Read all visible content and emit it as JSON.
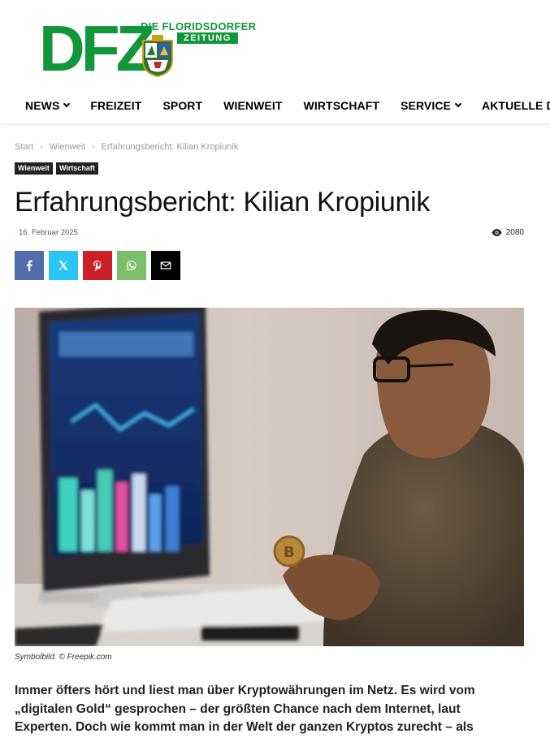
{
  "logo": {
    "main": "DFZ",
    "line1": "DIE FLORIDSDORFER",
    "line2": "ZEITUNG",
    "crest_icon": "coat-of-arms-icon"
  },
  "nav": {
    "items": [
      {
        "label": "NEWS",
        "dropdown": true
      },
      {
        "label": "FREIZEIT",
        "dropdown": false
      },
      {
        "label": "SPORT",
        "dropdown": false
      },
      {
        "label": "WIENWEIT",
        "dropdown": false
      },
      {
        "label": "WIRTSCHAFT",
        "dropdown": false
      },
      {
        "label": "SERVICE",
        "dropdown": true
      },
      {
        "label": "AKTUELLE DFZ ALS",
        "dropdown": false
      }
    ]
  },
  "breadcrumb": {
    "items": [
      "Start",
      "Wienweit",
      "Erfahrungsbericht: Kilian Kropiunik"
    ],
    "separator": "›"
  },
  "categories": [
    "Wienweit",
    "Wirtschaft"
  ],
  "article": {
    "title": "Erfahrungsbericht: Kilian Kropiunik",
    "date": "16. Februar 2025",
    "views": "2080",
    "caption": "Symbolbild. © Freepik.com",
    "intro": "Immer öfters hört und liest man über Kryptowährungen im Netz. Es wird vom „digitalen Gold“ gesprochen – der größten Chance nach dem Internet, laut Experten. Doch wie kommt man in der Welt der ganzen Kryptos zurecht – als"
  },
  "share": [
    {
      "name": "facebook",
      "icon": "facebook-icon",
      "color": "#516eab"
    },
    {
      "name": "x",
      "icon": "x-icon",
      "color": "#29c5f6"
    },
    {
      "name": "pinterest",
      "icon": "pinterest-icon",
      "color": "#ca212a"
    },
    {
      "name": "whatsapp",
      "icon": "whatsapp-icon",
      "color": "#7bbf6a"
    },
    {
      "name": "email",
      "icon": "mail-icon",
      "color": "#000000"
    }
  ],
  "colors": {
    "brand_green": "#12963a",
    "category_bg": "#222222"
  }
}
